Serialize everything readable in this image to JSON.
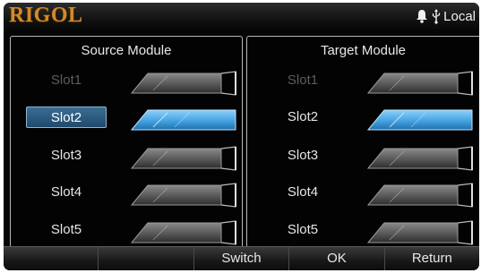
{
  "brand": "RIGOL",
  "status": {
    "icons": [
      "bell-icon",
      "usb-icon"
    ],
    "mode_text": "Local"
  },
  "panels": {
    "source": {
      "title": "Source Module",
      "slots": [
        {
          "label": "Slot1",
          "state": "disabled"
        },
        {
          "label": "Slot2",
          "state": "selected"
        },
        {
          "label": "Slot3",
          "state": "normal"
        },
        {
          "label": "Slot4",
          "state": "normal"
        },
        {
          "label": "Slot5",
          "state": "normal"
        }
      ]
    },
    "target": {
      "title": "Target Module",
      "slots": [
        {
          "label": "Slot1",
          "state": "disabled"
        },
        {
          "label": "Slot2",
          "state": "selected"
        },
        {
          "label": "Slot3",
          "state": "normal"
        },
        {
          "label": "Slot4",
          "state": "normal"
        },
        {
          "label": "Slot5",
          "state": "normal"
        }
      ]
    }
  },
  "softkeys": [
    "",
    "",
    "Switch",
    "OK",
    "Return"
  ],
  "colors": {
    "brand": "#d48a26",
    "module_selected": "#4aa8e4",
    "module_normal": "#6c6c6c",
    "label_selected_bg": "#2a5a80"
  }
}
